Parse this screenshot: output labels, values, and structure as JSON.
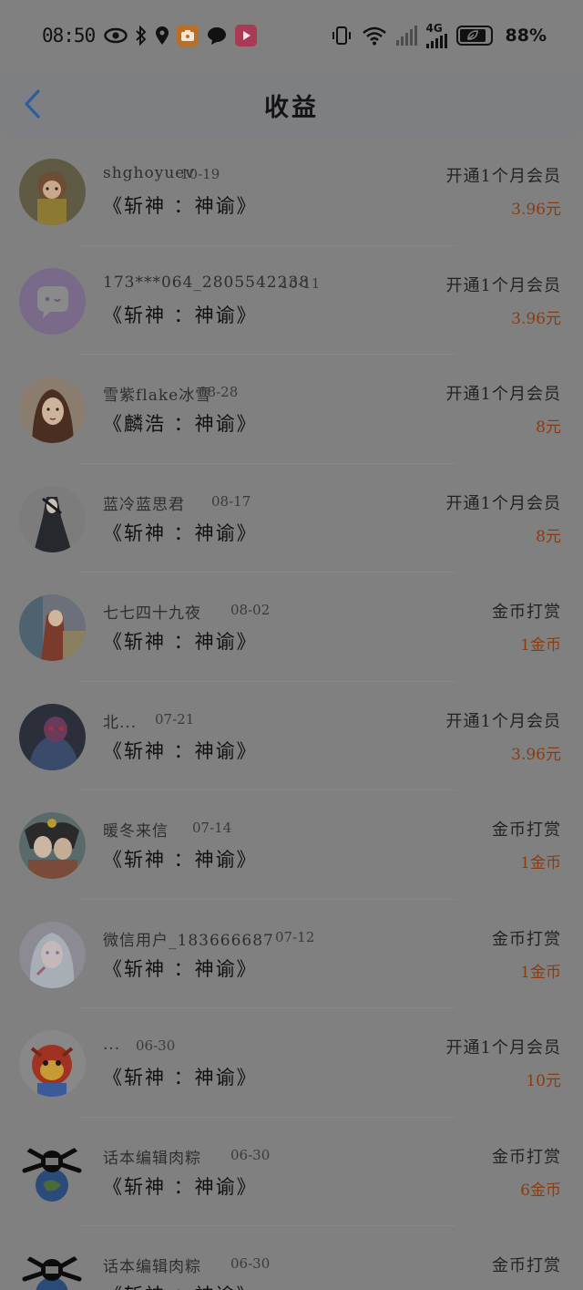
{
  "status_bar": {
    "time": "08:50",
    "network": "4G",
    "battery_percent": "88%",
    "icons": [
      "eye-icon",
      "bluetooth-icon",
      "location-icon",
      "app-notification-icon",
      "chat-bubble-icon",
      "video-app-icon",
      "vibrate-icon",
      "wifi-icon",
      "signal-icon",
      "battery-icon"
    ]
  },
  "header": {
    "title": "收益",
    "back_icon": "chevron-left-icon"
  },
  "colors": {
    "background": "#808080",
    "amount": "#8a3c10",
    "back_arrow": "#2a5f9a"
  },
  "income_list": [
    {
      "user": "shghoyuev",
      "date": "10-19",
      "work": "《斩神 ：神谕》",
      "type": "开通1个月会员",
      "amount": "3.96元"
    },
    {
      "user": "173***064_2805542238",
      "date": "10-11",
      "work": "《斩神 ：神谕》",
      "type": "开通1个月会员",
      "amount": "3.96元"
    },
    {
      "user": "雪紫flake冰雪",
      "date": "08-28",
      "work": "《麟浩 ：神谕》",
      "type": "开通1个月会员",
      "amount": "8元"
    },
    {
      "user": "蓝冷蓝思君",
      "date": "08-17",
      "work": "《斩神 ：神谕》",
      "type": "开通1个月会员",
      "amount": "8元"
    },
    {
      "user": "七七四十九夜",
      "date": "08-02",
      "work": "《斩神 ：神谕》",
      "type": "金币打赏",
      "amount": "1金币"
    },
    {
      "user": "北...",
      "date": "07-21",
      "work": "《斩神 ：神谕》",
      "type": "开通1个月会员",
      "amount": "3.96元"
    },
    {
      "user": "暖冬来信",
      "date": "07-14",
      "work": "《斩神 ：神谕》",
      "type": "金币打赏",
      "amount": "1金币"
    },
    {
      "user": "微信用户_183666687",
      "date": "07-12",
      "work": "《斩神 ：神谕》",
      "type": "金币打赏",
      "amount": "1金币"
    },
    {
      "user": "...",
      "date": "06-30",
      "work": "《斩神 ：神谕》",
      "type": "开通1个月会员",
      "amount": "10元"
    },
    {
      "user": "话本编辑肉粽",
      "date": "06-30",
      "work": "《斩神 ：神谕》",
      "type": "金币打赏",
      "amount": "6金币"
    },
    {
      "user": "话本编辑肉粽",
      "date": "06-30",
      "work": "《斩神 ：神谕》",
      "type": "金币打赏",
      "amount": ""
    }
  ]
}
